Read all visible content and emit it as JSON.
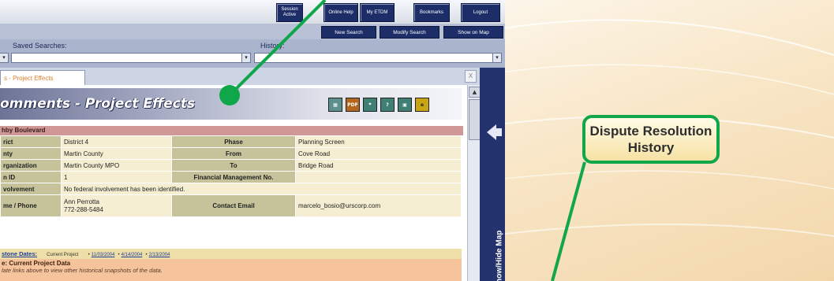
{
  "top_buttons": [
    "Session Active",
    "Online Help",
    "My ETDM",
    "Bookmarks",
    "Logout"
  ],
  "nav_buttons": [
    "New Search",
    "Modify Search",
    "Show on Map"
  ],
  "search": {
    "saved_label": "Saved Searches:",
    "history_label": "History:"
  },
  "tab_label": "s - Project Effects",
  "close_label": "X",
  "panel_title": "omments - Project Effects",
  "icons": [
    "grid-icon",
    "pdf-icon",
    "map-icon",
    "help-icon",
    "report-icon",
    "my-etdm-icon"
  ],
  "project_name": "hby Boulevard",
  "rows": [
    {
      "k1": "rict",
      "v1": "District 4",
      "k2": "Phase",
      "v2": "Planning Screen"
    },
    {
      "k1": "nty",
      "v1": "Martin County",
      "k2": "From",
      "v2": "Cove Road"
    },
    {
      "k1": "rganization",
      "v1": "Martin County MPO",
      "k2": "To",
      "v2": "Bridge Road"
    },
    {
      "k1": "n ID",
      "v1": "1",
      "k2": "Financial Management No.",
      "v2": ""
    },
    {
      "k1": "volvement",
      "v1": "No federal involvement has been identified.",
      "k2": "",
      "v2": ""
    },
    {
      "k1": "me / Phone",
      "v1": "Ann Perrotta\n772-288-5484",
      "k2": "Contact Email",
      "v2": "marcelo_bosio@urscorp.com"
    }
  ],
  "milestone": {
    "label": "stone Dates:",
    "current": "Current Project",
    "dates": [
      "11/03/2004",
      "4/14/2004",
      "2/13/2004"
    ]
  },
  "note": {
    "title": "e: Current Project Data",
    "subtitle": "late links above to view other historical snapshots of the data."
  },
  "side_tab_label": "Show/Hide Map",
  "callout_text": "Dispute Resolution History",
  "colors": {
    "nav": "#24336d",
    "callout_border": "#10a64a",
    "accent": "#e0802a"
  }
}
